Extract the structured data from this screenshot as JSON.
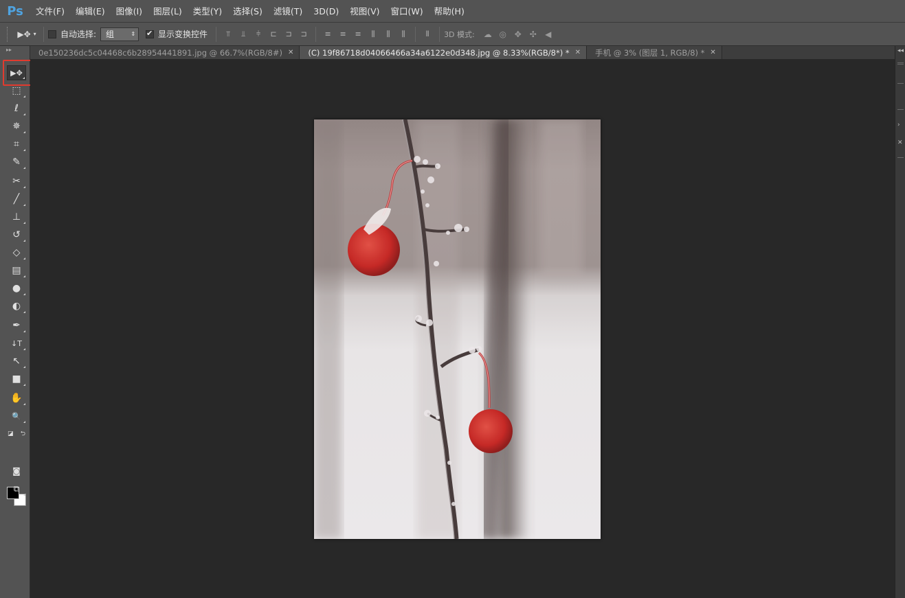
{
  "app": {
    "logo": "Ps"
  },
  "menu": [
    "文件(F)",
    "编辑(E)",
    "图像(I)",
    "图层(L)",
    "类型(Y)",
    "选择(S)",
    "滤镜(T)",
    "3D(D)",
    "视图(V)",
    "窗口(W)",
    "帮助(H)"
  ],
  "options": {
    "tool_glyph": "▶✥",
    "auto_select_label": "自动选择:",
    "auto_select_checked": false,
    "auto_select_value": "组",
    "show_transform_label": "显示变换控件",
    "show_transform_checked": true,
    "mode3d_label": "3D 模式:",
    "align_icons": [
      "align-top-edges-icon",
      "align-vertical-centers-icon",
      "align-bottom-edges-icon",
      "align-left-edges-icon",
      "align-horizontal-centers-icon",
      "align-right-edges-icon"
    ],
    "distribute_icons": [
      "distribute-top-icon",
      "distribute-vcenter-icon",
      "distribute-bottom-icon",
      "distribute-left-icon",
      "distribute-hcenter-icon",
      "distribute-right-icon"
    ],
    "mode3d_icons": [
      "rotate-3d-icon",
      "roll-3d-icon",
      "drag-3d-icon",
      "slide-3d-icon",
      "scale-3d-icon"
    ]
  },
  "tabs": [
    {
      "title": "0e150236dc5c04468c6b28954441891.jpg @ 66.7%(RGB/8#)",
      "active": false
    },
    {
      "title": "(C) 19f86718d04066466a34a6122e0d348.jpg @ 8.33%(RGB/8*) *",
      "active": true
    },
    {
      "title": "手机 @ 3% (图层 1, RGB/8) *",
      "active": false
    }
  ],
  "tools": [
    {
      "name": "move-tool",
      "glyph": "▶✥",
      "selected": true
    },
    {
      "name": "marquee-tool",
      "glyph": "⬚"
    },
    {
      "name": "lasso-tool",
      "glyph": "ℓ"
    },
    {
      "name": "magic-wand-tool",
      "glyph": "✵"
    },
    {
      "name": "crop-tool",
      "glyph": "⌗"
    },
    {
      "name": "eyedropper-tool",
      "glyph": "✎"
    },
    {
      "name": "healing-brush-tool",
      "glyph": "✂"
    },
    {
      "name": "brush-tool",
      "glyph": "╱"
    },
    {
      "name": "clone-stamp-tool",
      "glyph": "⊥"
    },
    {
      "name": "history-brush-tool",
      "glyph": "↺"
    },
    {
      "name": "eraser-tool",
      "glyph": "◇"
    },
    {
      "name": "gradient-tool",
      "glyph": "▤"
    },
    {
      "name": "blur-tool",
      "glyph": "●"
    },
    {
      "name": "dodge-tool",
      "glyph": "◐"
    },
    {
      "name": "pen-tool",
      "glyph": "✒"
    },
    {
      "name": "type-tool",
      "glyph": "↓T"
    },
    {
      "name": "path-selection-tool",
      "glyph": "↖"
    },
    {
      "name": "rectangle-tool",
      "glyph": "■"
    },
    {
      "name": "hand-tool",
      "glyph": "✋"
    },
    {
      "name": "zoom-tool",
      "glyph": "🔍"
    }
  ],
  "colors": {
    "accent": "#4fa3e0",
    "highlight": "#e23a2e",
    "foreground": "#000000",
    "background": "#ffffff"
  }
}
